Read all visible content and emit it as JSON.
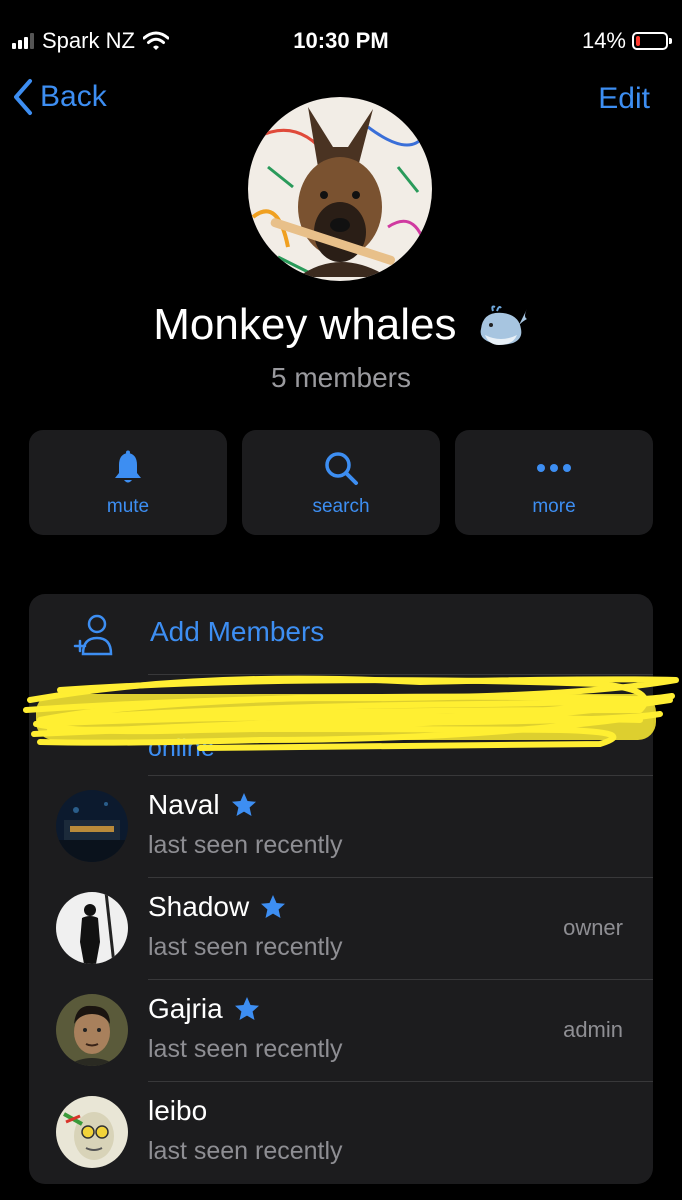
{
  "status_bar": {
    "carrier": "Spark NZ",
    "time": "10:30 PM",
    "battery_percent": "14%",
    "battery_level": 0.14,
    "battery_color": "#ff3b30"
  },
  "nav": {
    "back_label": "Back",
    "edit_label": "Edit"
  },
  "group": {
    "title": "Monkey whales",
    "member_count": "5 members"
  },
  "actions": [
    {
      "label": "mute",
      "icon": "bell-icon"
    },
    {
      "label": "search",
      "icon": "search-icon"
    },
    {
      "label": "more",
      "icon": "more-icon"
    }
  ],
  "members_section": {
    "add_label": "Add Members",
    "hidden_member_seen": "online",
    "members": [
      {
        "name": "Naval",
        "status": "last seen recently",
        "role": "",
        "starred": true
      },
      {
        "name": "Shadow",
        "status": "last seen recently",
        "role": "owner",
        "starred": true
      },
      {
        "name": "Gajria",
        "status": "last seen recently",
        "role": "admin",
        "starred": true
      },
      {
        "name": "leibo",
        "status": "last seen recently",
        "role": "",
        "starred": false
      }
    ]
  },
  "colors": {
    "accent": "#3d8ef2",
    "background": "#000000",
    "card": "#1c1c1e",
    "secondary_text": "#8e8e93",
    "redaction": "#ffee33"
  }
}
